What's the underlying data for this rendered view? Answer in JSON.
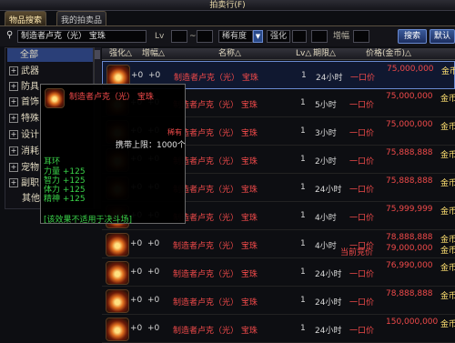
{
  "window": {
    "title": "拍卖行(F)"
  },
  "tabs": [
    {
      "label": "物品搜索",
      "active": true
    },
    {
      "label": "我的拍卖品",
      "active": false
    }
  ],
  "search": {
    "query_value": "制造者卢克（光） 宝珠",
    "level_label": "Lv",
    "level_from": "",
    "level_to": "",
    "rarity_value": "稀有度",
    "strengthen_label": "强化",
    "increase_label": "增幅",
    "search_button": "搜索",
    "extra_button": "默认"
  },
  "sidebar": {
    "items": [
      {
        "label": "全部",
        "expandable": false
      },
      {
        "label": "武器",
        "expandable": true
      },
      {
        "label": "防具",
        "expandable": true
      },
      {
        "label": "首饰",
        "expandable": true
      },
      {
        "label": "特殊",
        "expandable": true
      },
      {
        "label": "设计",
        "expandable": true
      },
      {
        "label": "消耗",
        "expandable": true
      },
      {
        "label": "宠物",
        "expandable": true
      },
      {
        "label": "副职",
        "expandable": true
      },
      {
        "label": "其他",
        "expandable": false
      }
    ]
  },
  "table": {
    "headers": {
      "strengthen": "强化△",
      "increase": "增幅△",
      "name": "名称△",
      "level": "Lv△",
      "remaining": "期限△",
      "price": "价格(金币)△"
    },
    "rows": [
      {
        "str": "+0",
        "lvl": "+0",
        "name": "制造者卢克（光） 宝珠",
        "lv": "1",
        "time": "24小时",
        "pa": "一口价",
        "pb": "75,000,000",
        "pb2": "",
        "gold": "金币",
        "gold2": ""
      },
      {
        "str": "+0",
        "lvl": "+0",
        "name": "制造者卢克（光） 宝珠",
        "lv": "1",
        "time": "5小时",
        "pa": "一口价",
        "pb": "75,000,000",
        "pb2": "",
        "gold": "金币",
        "gold2": ""
      },
      {
        "str": "+0",
        "lvl": "+0",
        "name": "制造者卢克（光） 宝珠",
        "lv": "1",
        "time": "3小时",
        "pa": "一口价",
        "pb": "75,000,000",
        "pb2": "",
        "gold": "金币",
        "gold2": ""
      },
      {
        "str": "+0",
        "lvl": "+0",
        "name": "制造者卢克（光） 宝珠",
        "lv": "1",
        "time": "2小时",
        "pa": "一口价",
        "pb": "75,888,888",
        "pb2": "",
        "gold": "金币",
        "gold2": ""
      },
      {
        "str": "+0",
        "lvl": "+0",
        "name": "制造者卢克（光） 宝珠",
        "lv": "1",
        "time": "24小时",
        "pa": "一口价",
        "pb": "75,888,888",
        "pb2": "",
        "gold": "金币",
        "gold2": ""
      },
      {
        "str": "+0",
        "lvl": "+0",
        "name": "制造者卢克（光） 宝珠",
        "lv": "1",
        "time": "4小时",
        "pa": "一口价",
        "pb": "75,999,999",
        "pb2": "",
        "gold": "金币",
        "gold2": ""
      },
      {
        "str": "+0",
        "lvl": "+0",
        "name": "制造者卢克（光） 宝珠",
        "lv": "1",
        "time": "4小时",
        "pa": "一口价",
        "pa2": "当前竞价",
        "pb": "78,888,888",
        "pb2": "79,000,000",
        "gold": "金币",
        "gold2": "金币"
      },
      {
        "str": "+0",
        "lvl": "+0",
        "name": "制造者卢克（光） 宝珠",
        "lv": "1",
        "time": "24小时",
        "pa": "一口价",
        "pb": "76,990,000",
        "pb2": "",
        "gold": "金币",
        "gold2": ""
      },
      {
        "str": "+0",
        "lvl": "+0",
        "name": "制造者卢克（光） 宝珠",
        "lv": "1",
        "time": "24小时",
        "pa": "一口价",
        "pb": "78,888,888",
        "pb2": "",
        "gold": "金币",
        "gold2": ""
      },
      {
        "str": "+0",
        "lvl": "+0",
        "name": "制造者卢克（光） 宝珠",
        "lv": "1",
        "time": "24小时",
        "pa": "一口价",
        "pb": "150,000,000",
        "pb2": "",
        "gold": "金币",
        "gold2": ""
      }
    ]
  },
  "tooltip": {
    "name": "制造者卢克（光） 宝珠",
    "carry_limit": "携带上限：1000个",
    "flag": "稀有",
    "slot": "耳环",
    "stats": [
      "力量 +125",
      "智力 +125",
      "体力 +125",
      "精神 +125"
    ],
    "note": "[该效果不适用于决斗场]"
  },
  "colors": {
    "accent": "#2a3f78",
    "item_name": "#f04a4a",
    "stat_green": "#3ad44a",
    "gold": "#ffe070"
  }
}
